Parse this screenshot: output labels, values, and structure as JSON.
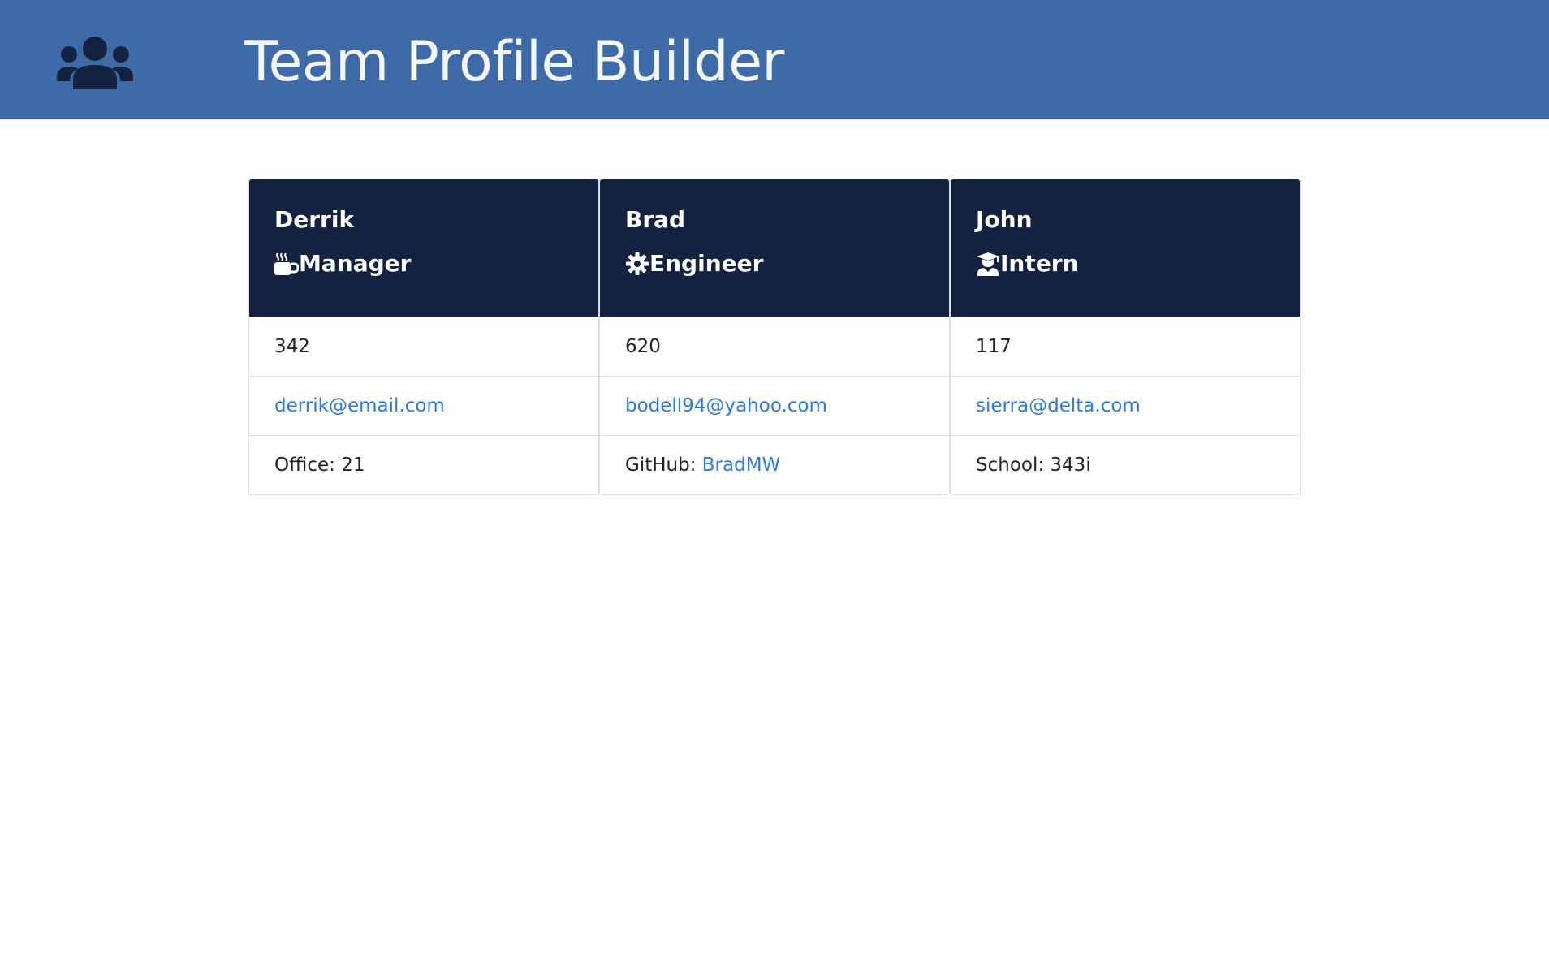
{
  "header": {
    "title": "Team Profile Builder",
    "logo_icon": "users-icon",
    "background": "#3e6ba8"
  },
  "cards": [
    {
      "name": "Derrik",
      "role": "Manager",
      "role_icon": "mug-hot-icon",
      "id": "342",
      "email": "derrik@email.com",
      "extra_label": "Office: 21",
      "extra_link": ""
    },
    {
      "name": "Brad",
      "role": "Engineer",
      "role_icon": "gear-icon",
      "id": "620",
      "email": "bodell94@yahoo.com",
      "extra_label": "GitHub: ",
      "extra_link": "BradMW"
    },
    {
      "name": "John",
      "role": "Intern",
      "role_icon": "graduate-icon",
      "id": "117",
      "email": "sierra@delta.com",
      "extra_label": "School: 343i",
      "extra_link": ""
    }
  ],
  "colors": {
    "card_header": "#142241",
    "link": "#2a7ae2",
    "border": "#dcdfe3"
  }
}
